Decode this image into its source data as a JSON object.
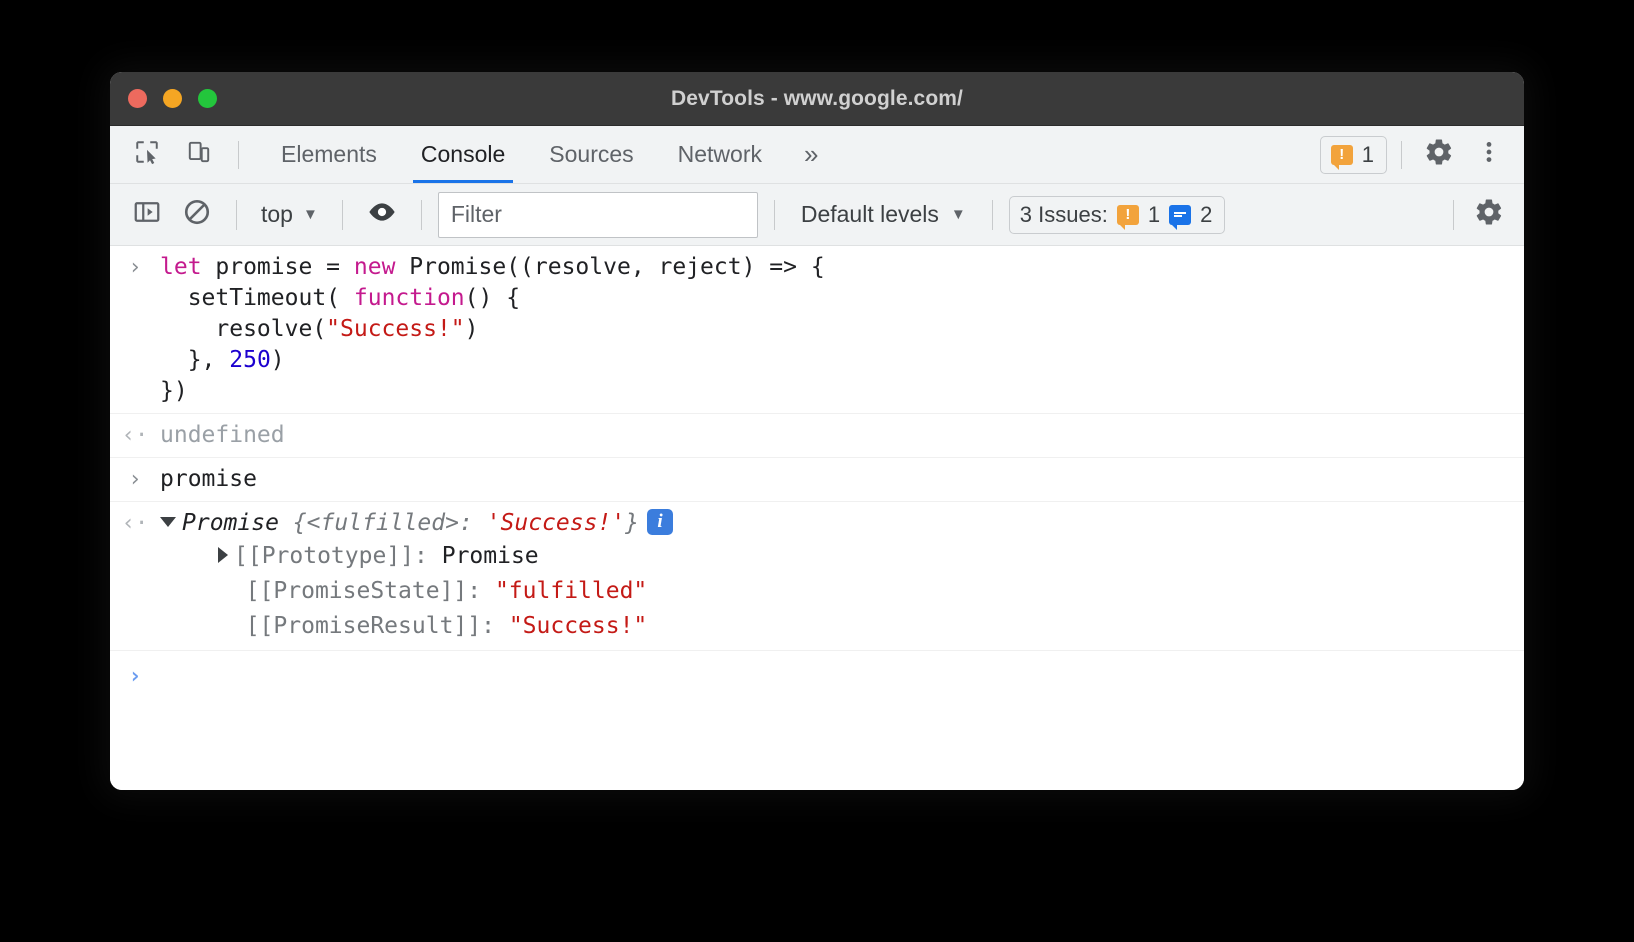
{
  "window": {
    "title": "DevTools - www.google.com/",
    "traffic_lights": [
      "close-button",
      "minimize-button",
      "maximize-button"
    ],
    "colors": {
      "close": "#ed6a5e",
      "minimize": "#f5a623",
      "maximize": "#23c63c"
    }
  },
  "tabbar": {
    "inspect_icon": "inspect-element-icon",
    "device_icon": "device-toolbar-icon",
    "tabs": [
      {
        "label": "Elements",
        "active": false
      },
      {
        "label": "Console",
        "active": true
      },
      {
        "label": "Sources",
        "active": false
      },
      {
        "label": "Network",
        "active": false
      }
    ],
    "more_tabs": "»",
    "warning_badge": {
      "icon": "warning-bubble-icon",
      "glyph": "!",
      "count": "1"
    },
    "settings_icon": "gear-icon",
    "menu_icon": "kebab-menu-icon",
    "accent": "#1a73e8"
  },
  "console_toolbar": {
    "sidebar_toggle_icon": "console-sidebar-icon",
    "clear_icon": "clear-console-icon",
    "context": {
      "label": "top",
      "caret": "▼"
    },
    "eye_icon": "live-expression-eye-icon",
    "filter": {
      "value": "",
      "placeholder": "Filter"
    },
    "levels": {
      "label": "Default levels",
      "caret": "▼"
    },
    "issues": {
      "label": "3 Issues:",
      "warning": {
        "icon": "warning-bubble-icon",
        "glyph": "!",
        "count": "1"
      },
      "info": {
        "icon": "info-bubble-icon",
        "count": "2"
      }
    },
    "settings_icon": "console-settings-gear-icon"
  },
  "console": {
    "gutter": {
      "input": "›",
      "output": "‹·",
      "prompt": "›"
    },
    "entries": [
      {
        "type": "input",
        "code_lines": [
          [
            {
              "t": "let ",
              "c": "kw"
            },
            {
              "t": "promise = ",
              "c": "plain"
            },
            {
              "t": "new ",
              "c": "kw"
            },
            {
              "t": "Promise((resolve, reject) => {",
              "c": "plain"
            }
          ],
          [
            {
              "t": "  setTimeout( ",
              "c": "plain"
            },
            {
              "t": "function",
              "c": "kw"
            },
            {
              "t": "() {",
              "c": "plain"
            }
          ],
          [
            {
              "t": "    resolve(",
              "c": "plain"
            },
            {
              "t": "\"Success!\"",
              "c": "str"
            },
            {
              "t": ")",
              "c": "plain"
            }
          ],
          [
            {
              "t": "  }, ",
              "c": "plain"
            },
            {
              "t": "250",
              "c": "num"
            },
            {
              "t": ")",
              "c": "plain"
            }
          ],
          [
            {
              "t": "})",
              "c": "plain"
            }
          ]
        ]
      },
      {
        "type": "output",
        "text": "undefined"
      },
      {
        "type": "input",
        "code_lines": [
          [
            {
              "t": "promise",
              "c": "plain"
            }
          ]
        ]
      },
      {
        "type": "object",
        "expanded": true,
        "head": {
          "name": "Promise",
          "meta_open": " {<fulfilled>: ",
          "value": "'Success!'",
          "meta_close": "}"
        },
        "info_badge": "i",
        "properties": [
          {
            "expandable": true,
            "key": "[[Prototype]]:",
            "value": "Promise",
            "value_kind": "plain"
          },
          {
            "expandable": false,
            "key": "[[PromiseState]]:",
            "value": "\"fulfilled\"",
            "value_kind": "string"
          },
          {
            "expandable": false,
            "key": "[[PromiseResult]]:",
            "value": "\"Success!\"",
            "value_kind": "string"
          }
        ]
      }
    ]
  }
}
